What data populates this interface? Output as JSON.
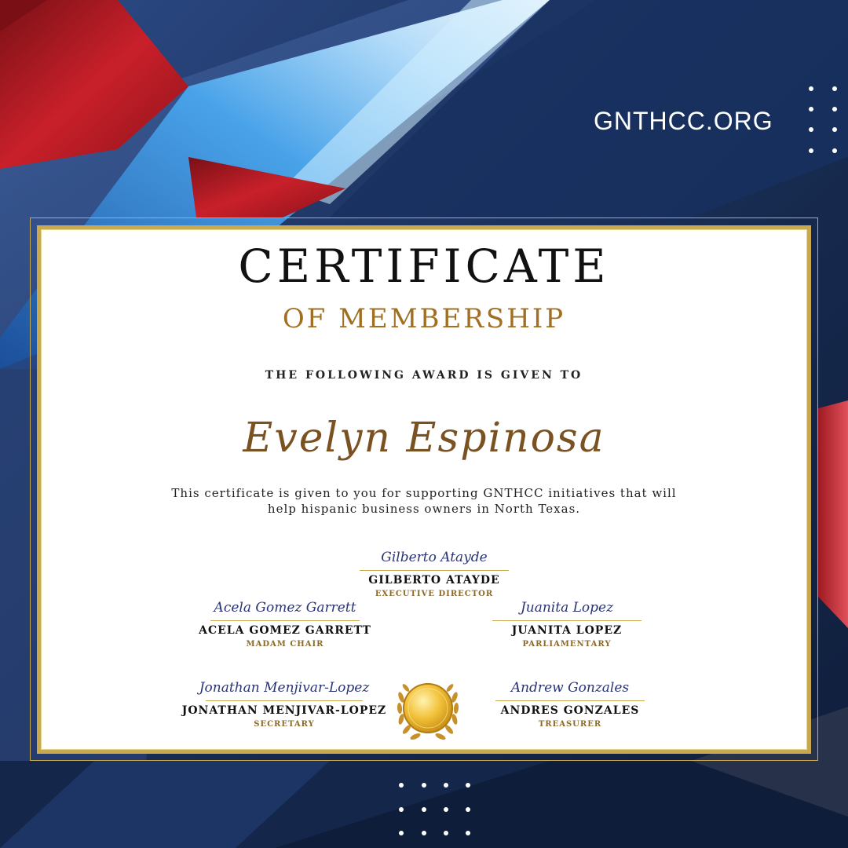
{
  "site_url": "GNTHCC.ORG",
  "certificate": {
    "title": "CERTIFICATE",
    "subtitle": "OF MEMBERSHIP",
    "given_to_text": "THE FOLLOWING AWARD IS GIVEN TO",
    "recipient": "Evelyn Espinosa",
    "description_line1": "This certificate is given to you for supporting GNTHCC initiatives that will",
    "description_line2": "help  hispanic business owners in North Texas."
  },
  "signatories": [
    {
      "signature": "Gilberto Atayde",
      "name": "GILBERTO ATAYDE",
      "role": "EXECUTIVE DIRECTOR"
    },
    {
      "signature": "Acela Gomez Garrett",
      "name": "ACELA GOMEZ GARRETT",
      "role": "MADAM CHAIR"
    },
    {
      "signature": "Juanita Lopez",
      "name": "JUANITA LOPEZ",
      "role": "PARLIAMENTARY"
    },
    {
      "signature": "Jonathan Menjivar-Lopez",
      "name": "JONATHAN MENJIVAR-LOPEZ",
      "role": "SECRETARY"
    },
    {
      "signature": "Andrew Gonzales",
      "name": "ANDRES GONZALES",
      "role": "TREASURER"
    }
  ],
  "colors": {
    "gold": "#c9a94f",
    "brown_accent": "#a06f22",
    "navy": "#1b2f57",
    "red": "#b8212b",
    "sky_blue": "#4aa3e8"
  },
  "icons": [
    "decorative-dot-grid",
    "gold-seal-laurel-icon"
  ]
}
